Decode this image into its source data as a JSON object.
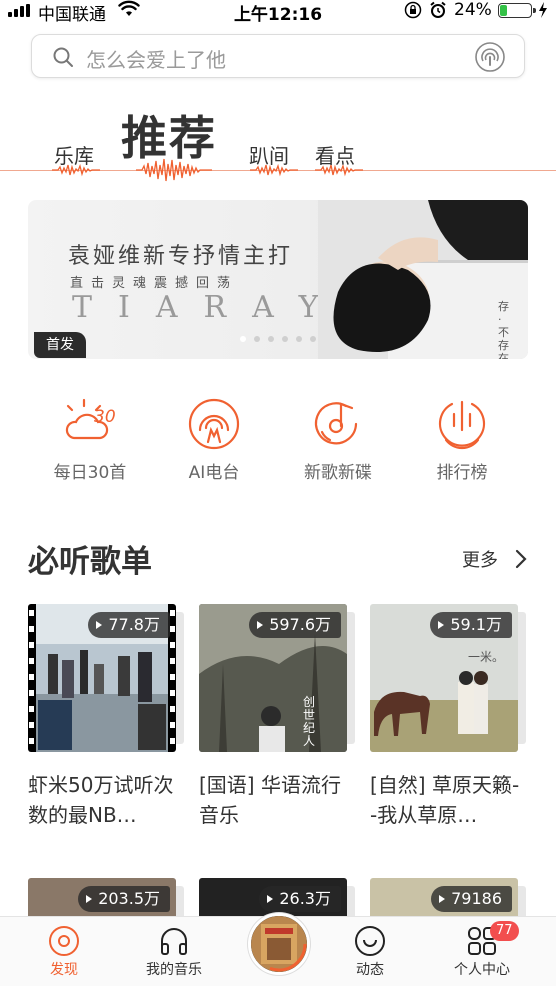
{
  "status_bar": {
    "carrier": "中国联通",
    "time": "上午12:16",
    "battery_percent": "24%",
    "battery_level": 0.24,
    "icons": [
      "signal-icon",
      "wifi-icon",
      "orientation-lock-icon",
      "alarm-icon",
      "battery-icon",
      "charging-icon"
    ]
  },
  "search": {
    "placeholder": "怎么会爱上了他",
    "icons": [
      "search-icon",
      "voice-recognition-icon"
    ]
  },
  "tabs": [
    {
      "label": "乐库",
      "active": false
    },
    {
      "label": "推荐",
      "active": true
    },
    {
      "label": "趴间",
      "active": false
    },
    {
      "label": "看点",
      "active": false
    }
  ],
  "banner": {
    "title": "袁娅维新专抒情主打",
    "subtitle": "直击灵魂震撼回荡",
    "english": "TIARAY",
    "vertical_text": "存·不存在",
    "badge": "首发",
    "slide_count": 6,
    "active_slide": 1
  },
  "quick_entries": [
    {
      "label": "每日30首",
      "icon": "daily-30-icon"
    },
    {
      "label": "AI电台",
      "icon": "ai-radio-icon"
    },
    {
      "label": "新歌新碟",
      "icon": "new-music-icon"
    },
    {
      "label": "排行榜",
      "icon": "chart-ranking-icon"
    }
  ],
  "section": {
    "title": "必听歌单",
    "more": "更多"
  },
  "playlists": [
    {
      "plays": "77.8万",
      "name": "虾米50万试听次数的最NB…"
    },
    {
      "plays": "597.6万",
      "name": "[国语] 华语流行音乐"
    },
    {
      "plays": "59.1万",
      "name": "[自然] 草原天籁--我从草原…"
    },
    {
      "plays": "203.5万",
      "name": ""
    },
    {
      "plays": "26.3万",
      "name": ""
    },
    {
      "plays": "79186",
      "name": ""
    }
  ],
  "cover_texts": {
    "cover2": "创世纪人",
    "cover3": "一米。"
  },
  "bottom_nav": [
    {
      "label": "发现",
      "icon": "discover-icon",
      "active": true
    },
    {
      "label": "我的音乐",
      "icon": "headphones-icon",
      "active": false
    },
    {
      "label": "",
      "icon": "now-playing-disc",
      "active": false
    },
    {
      "label": "动态",
      "icon": "feed-icon",
      "active": false
    },
    {
      "label": "个人中心",
      "icon": "profile-icon",
      "active": false
    }
  ],
  "notification_badge": "77",
  "colors": {
    "accent": "#f06131",
    "badge_red": "#f24e4e",
    "battery_green": "#33c146"
  }
}
